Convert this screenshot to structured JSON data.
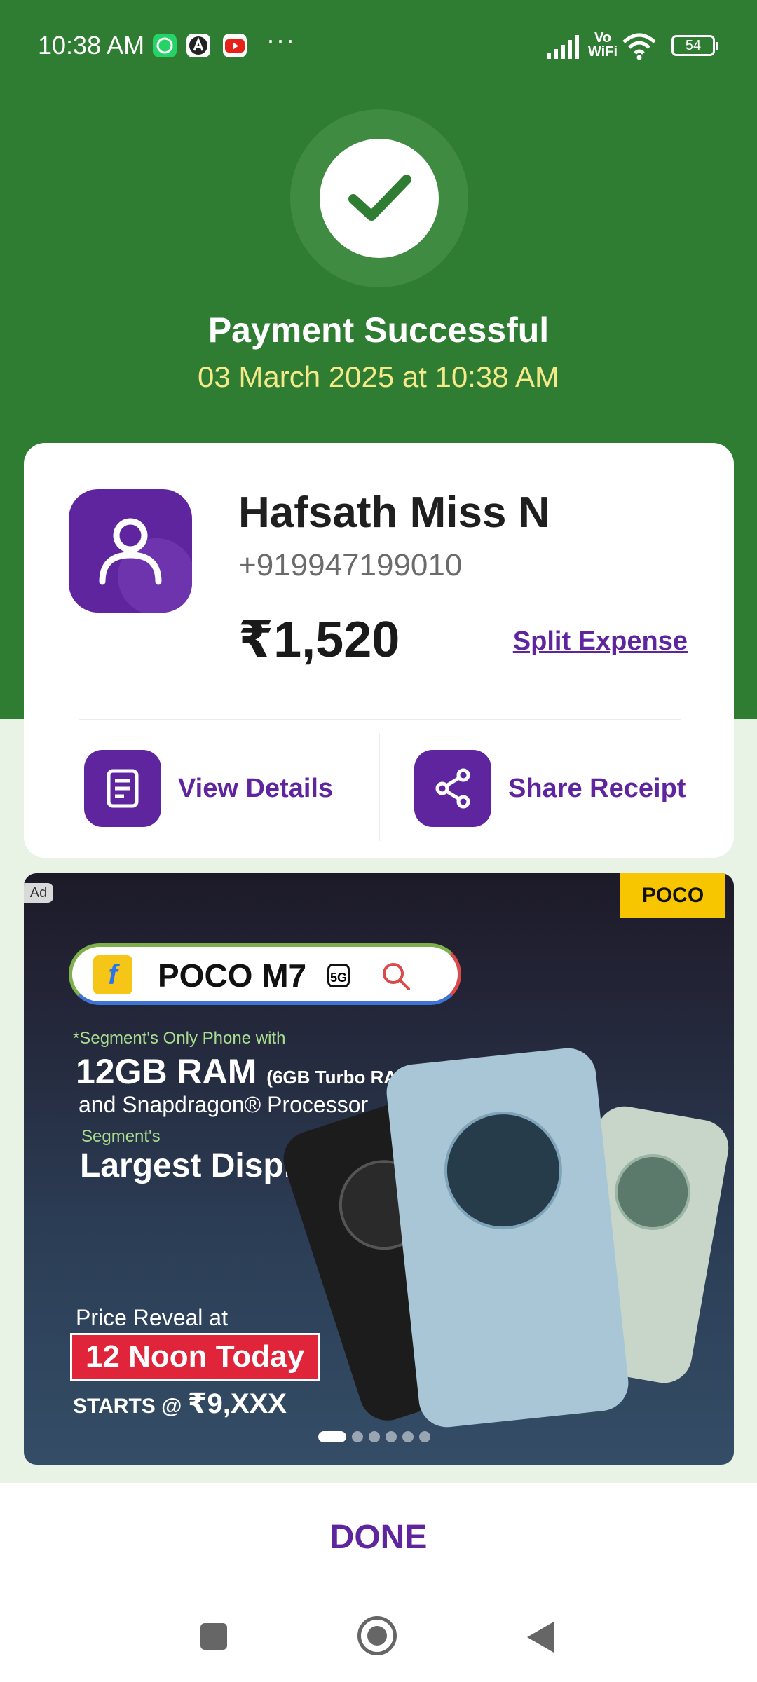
{
  "status_bar": {
    "time": "10:38 AM",
    "more": "···",
    "network": "Vo WiFi",
    "battery": "54"
  },
  "header": {
    "status": "Payment Successful",
    "datetime": "03 March 2025 at 10:38 AM"
  },
  "payee": {
    "name": "Hafsath Miss N",
    "phone": "+919947199010",
    "amount": "₹1,520",
    "split_label": "Split Expense"
  },
  "actions": {
    "view_details": "View Details",
    "share_receipt": "Share Receipt"
  },
  "ad": {
    "tag": "Ad",
    "brand": "POCO",
    "search_text": "POCO M7",
    "network_badge": "5G",
    "line1": "*Segment's Only Phone with",
    "ram": "12GB RAM",
    "ram_small": "(6GB Turbo RAM)",
    "processor": "and Snapdragon® Processor",
    "segment": "Segment's",
    "display": "Largest Display",
    "price_reveal": "Price Reveal at",
    "noon": "12 Noon Today",
    "starts": "STARTS @",
    "starts_price": "₹9,XXX",
    "carousel_pages": 6,
    "carousel_active": 1
  },
  "footer": {
    "done_label": "DONE"
  },
  "colors": {
    "header_green": "#2f7d32",
    "brand_purple": "#5f259f",
    "date_yellow": "#f6e98a"
  }
}
